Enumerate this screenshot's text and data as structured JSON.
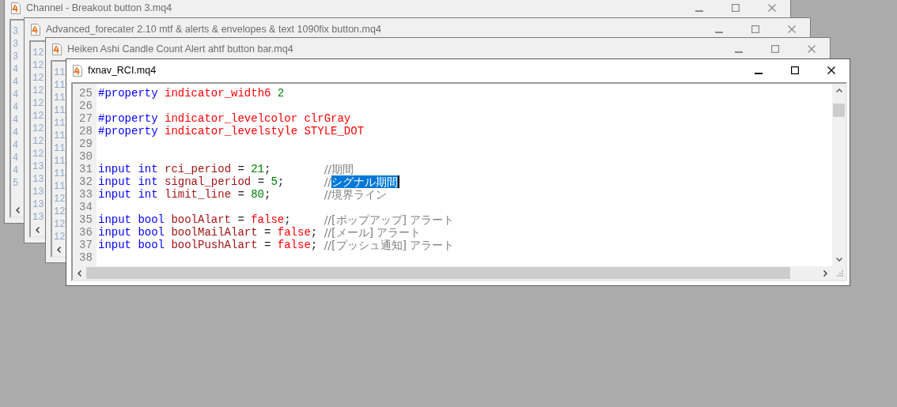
{
  "windows": [
    {
      "title": "Channel - Breakout button 3.mq4",
      "active": false,
      "gutter": [
        "3",
        "3",
        "3",
        "4",
        "4",
        "4",
        "4",
        "4",
        "4",
        "4",
        "4",
        "4",
        "5"
      ]
    },
    {
      "title": "Advanced_forecater 2.10 mtf & alerts & envelopes & text 1090fix button.mq4",
      "active": false,
      "gutter": [
        "12",
        "12",
        "12",
        "12",
        "12",
        "12",
        "12",
        "12",
        "12",
        "13",
        "13",
        "13",
        "13",
        "13"
      ]
    },
    {
      "title": "Heiken Ashi Candle Count Alert ahtf button bar.mq4",
      "active": false,
      "gutter": [
        "11",
        "11",
        "11",
        "11",
        "11",
        "11",
        "11",
        "11",
        "11",
        "11",
        "12",
        "12",
        "12",
        "12"
      ]
    },
    {
      "title": "fxnav_RCI.mq4",
      "active": true,
      "lines": [
        {
          "number": "25",
          "tokens": [
            {
              "kind": "keyword",
              "text": "#property"
            },
            {
              "kind": "constant",
              "text": "indicator_width6"
            },
            {
              "kind": "number",
              "text": "2"
            }
          ]
        },
        {
          "number": "26"
        },
        {
          "number": "27",
          "tokens": [
            {
              "kind": "keyword",
              "text": "#property"
            },
            {
              "kind": "constant",
              "text": "indicator_levelcolor"
            },
            {
              "kind": "constant",
              "text": "clrGray"
            }
          ]
        },
        {
          "number": "28",
          "tokens": [
            {
              "kind": "keyword",
              "text": "#property"
            },
            {
              "kind": "constant",
              "text": "indicator_levelstyle"
            },
            {
              "kind": "constant",
              "text": "STYLE_DOT"
            }
          ]
        },
        {
          "number": "29"
        },
        {
          "number": "30"
        },
        {
          "number": "31",
          "tokens": [
            {
              "kind": "keyword",
              "text": "input"
            },
            {
              "kind": "keyword",
              "text": "int"
            },
            {
              "kind": "ident",
              "text": "rci_period"
            },
            {
              "kind": "op",
              "text": "="
            },
            {
              "kind": "number",
              "text": "21"
            },
            {
              "kind": "punct",
              "text": ";"
            }
          ],
          "comment": [
            {
              "text": "//期間",
              "selected": false
            }
          ]
        },
        {
          "number": "32",
          "tokens": [
            {
              "kind": "keyword",
              "text": "input"
            },
            {
              "kind": "keyword",
              "text": "int"
            },
            {
              "kind": "ident",
              "text": "signal_period"
            },
            {
              "kind": "op",
              "text": "="
            },
            {
              "kind": "number",
              "text": "5"
            },
            {
              "kind": "punct",
              "text": ";"
            }
          ],
          "comment": [
            {
              "text": "//",
              "selected": false
            },
            {
              "text": "シグナル期間",
              "selected": true
            }
          ]
        },
        {
          "number": "33",
          "tokens": [
            {
              "kind": "keyword",
              "text": "input"
            },
            {
              "kind": "keyword",
              "text": "int"
            },
            {
              "kind": "ident",
              "text": "limit_line"
            },
            {
              "kind": "op",
              "text": "="
            },
            {
              "kind": "number",
              "text": "80"
            },
            {
              "kind": "punct",
              "text": ";"
            }
          ],
          "comment": [
            {
              "text": "//境界ライン",
              "selected": false
            }
          ]
        },
        {
          "number": "34"
        },
        {
          "number": "35",
          "tokens": [
            {
              "kind": "keyword",
              "text": "input"
            },
            {
              "kind": "keyword",
              "text": "bool"
            },
            {
              "kind": "ident",
              "text": "boolAlart"
            },
            {
              "kind": "op",
              "text": "="
            },
            {
              "kind": "constant",
              "text": "false"
            },
            {
              "kind": "punct",
              "text": ";"
            }
          ],
          "comment": [
            {
              "text": "//[ポップアップ] アラート",
              "selected": false
            }
          ]
        },
        {
          "number": "36",
          "tokens": [
            {
              "kind": "keyword",
              "text": "input"
            },
            {
              "kind": "keyword",
              "text": "bool"
            },
            {
              "kind": "ident",
              "text": "boolMailAlart"
            },
            {
              "kind": "op",
              "text": "="
            },
            {
              "kind": "constant",
              "text": "false"
            },
            {
              "kind": "punct",
              "text": ";"
            }
          ],
          "comment": [
            {
              "text": "//[メール] アラート",
              "selected": false
            }
          ]
        },
        {
          "number": "37",
          "tokens": [
            {
              "kind": "keyword",
              "text": "input"
            },
            {
              "kind": "keyword",
              "text": "bool"
            },
            {
              "kind": "ident",
              "text": "boolPushAlart"
            },
            {
              "kind": "op",
              "text": "="
            },
            {
              "kind": "constant",
              "text": "false"
            },
            {
              "kind": "punct",
              "text": ";"
            }
          ],
          "comment": [
            {
              "text": "//[プッシュ通知] アラート",
              "selected": false
            }
          ]
        },
        {
          "number": "38"
        }
      ]
    }
  ]
}
